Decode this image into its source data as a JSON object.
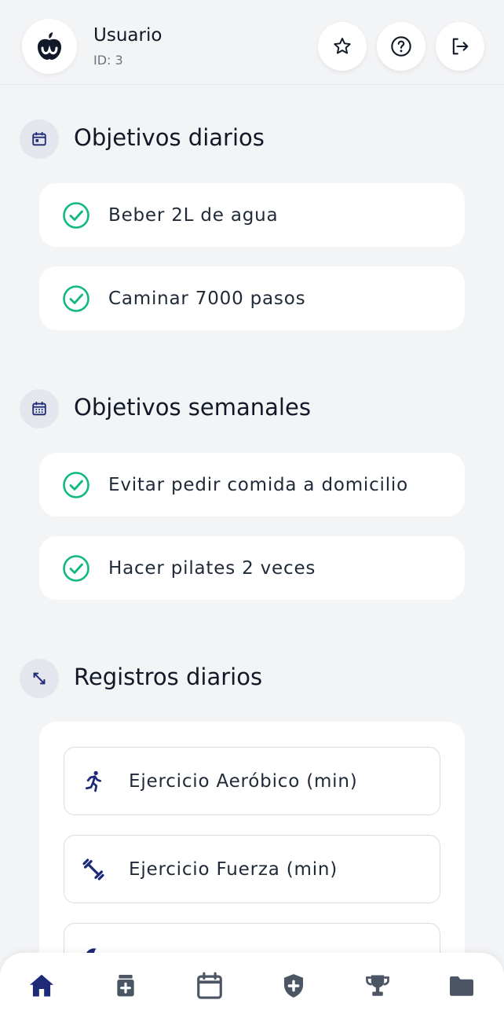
{
  "header": {
    "user_name": "Usuario",
    "user_id": "ID: 3",
    "icons": {
      "logo": "apple-logo-icon",
      "favorite": "star-icon",
      "help": "help-circle-icon",
      "logout": "logout-icon"
    }
  },
  "daily_goals": {
    "title": "Objetivos diarios",
    "icon": "calendar-icon",
    "items": [
      {
        "label": "Beber 2L de agua",
        "done": true
      },
      {
        "label": "Caminar 7000 pasos",
        "done": true
      }
    ]
  },
  "weekly_goals": {
    "title": "Objetivos semanales",
    "icon": "calendar-week-icon",
    "items": [
      {
        "label": "Evitar pedir comida a domicilio",
        "done": true
      },
      {
        "label": "Hacer pilates 2 veces",
        "done": true
      }
    ]
  },
  "daily_records": {
    "title": "Registros diarios",
    "icon": "resize-arrows-icon",
    "items": [
      {
        "label": "Ejercicio Aeróbico (min)",
        "icon": "running-icon"
      },
      {
        "label": "Ejercicio Fuerza (min)",
        "icon": "dumbbell-icon"
      }
    ]
  },
  "bottom_nav": {
    "items": [
      {
        "icon": "home-icon",
        "active": true
      },
      {
        "icon": "medicine-icon",
        "active": false
      },
      {
        "icon": "calendar-icon",
        "active": false
      },
      {
        "icon": "shield-plus-icon",
        "active": false
      },
      {
        "icon": "trophy-icon",
        "active": false
      },
      {
        "icon": "folder-icon",
        "active": false
      }
    ]
  },
  "colors": {
    "primary": "#1e2a78",
    "check": "#10b981",
    "background": "#f3f4f6",
    "card": "#ffffff",
    "nav_inactive": "#4b5563"
  }
}
